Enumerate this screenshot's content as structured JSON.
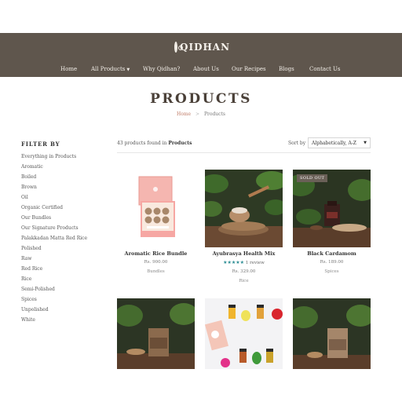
{
  "brand": {
    "name": "QIDHAN",
    "logo_icon": "qidhan-swirl-logo"
  },
  "nav": {
    "home": "Home",
    "all_products": "All Products",
    "why": "Why Qidhan?",
    "about": "About Us",
    "recipes": "Our Recipes",
    "blogs": "Blogs",
    "contact": "Contact Us"
  },
  "page": {
    "title": "PRODUCTS",
    "breadcrumb_home": "Home",
    "breadcrumb_sep": ">",
    "breadcrumb_current": "Products"
  },
  "filter": {
    "title": "FILTER BY",
    "items": [
      "Everything in Products",
      "Aromatic",
      "Boiled",
      "Brown",
      "Oil",
      "Organic Certified",
      "Our Bundles",
      "Our Signature Products",
      "Palakkadan Matta Red Rice",
      "Polished",
      "Raw",
      "Red Rice",
      "Rice",
      "Semi-Polished",
      "Spices",
      "Unpolished",
      "White"
    ]
  },
  "results": {
    "count_prefix": "43 products found in",
    "count_collection": "Products",
    "sort_label": "Sort by",
    "sort_value": "Alphabetically, A-Z"
  },
  "products": [
    {
      "name": "Aromatic Rice Bundle",
      "price": "Rs. 900.00",
      "category": "Bundles"
    },
    {
      "name": "Ayubrasya Health Mix",
      "rating": 5,
      "reviews": "1 review",
      "price": "Rs. 329.00",
      "category": "Rice"
    },
    {
      "name": "Black Cardamom",
      "badge": "SOLD OUT",
      "price": "Rs. 189.00",
      "category": "Spices"
    }
  ],
  "colors": {
    "header_bg": "#5f564d",
    "accent": "#c07b66",
    "star": "#2a8c93"
  }
}
